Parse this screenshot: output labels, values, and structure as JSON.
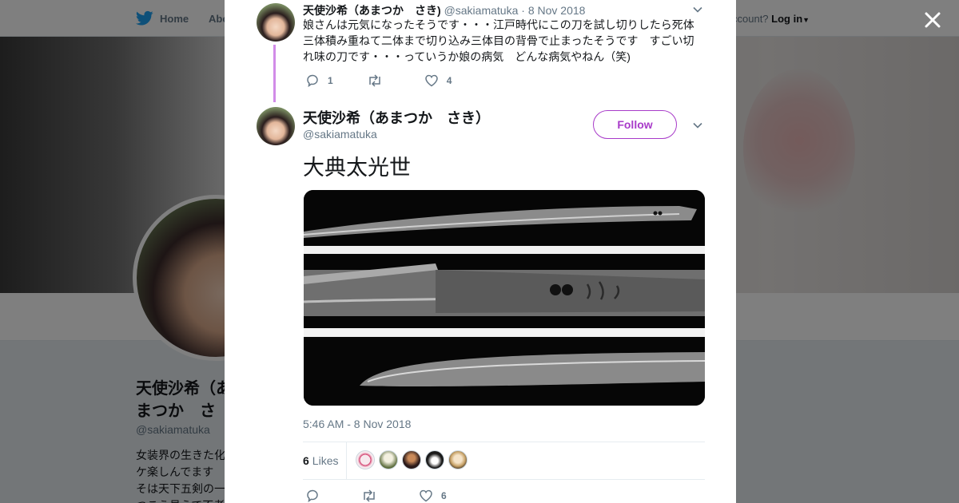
{
  "nav": {
    "home_label": "Home",
    "about_label": "Abo",
    "account_prompt": "ccount?",
    "login_label": "Log in"
  },
  "profile": {
    "name": "天使沙希（あまつか　さき）",
    "handle": "@sakiamatuka",
    "bio": "女装界の生きた化ケ楽しんでます そは天下五剣の一つこう見えて不者石"
  },
  "parent_tweet": {
    "name": "天使沙希（あまつか　さき)",
    "handle": "@sakiamatuka",
    "date": "· 8 Nov 2018",
    "text": "娘さんは元気になったそうです・・・江戸時代にこの刀を試し切りしたら死体三体積み重ねて二体まで切り込み三体目の背骨で止まったそうです　すごい切れ味の刀です・・・っていうか娘の病気　どんな病気やねん（笑)",
    "reply_count": "1",
    "retweet_count": "",
    "like_count": "4"
  },
  "main_tweet": {
    "name": "天使沙希（あまつか　さき）",
    "handle": "@sakiamatuka",
    "follow_label": "Follow",
    "text": "大典太光世",
    "timestamp": "5:46 AM - 8 Nov 2018",
    "likes_count": "6",
    "likes_label": "Likes",
    "reply_count": "",
    "retweet_count": "",
    "like_count": "6"
  },
  "colors": {
    "accent": "#a83bc9",
    "thread_line": "#d28ce8",
    "twitter_blue": "#1da1f2",
    "muted": "#657786"
  }
}
